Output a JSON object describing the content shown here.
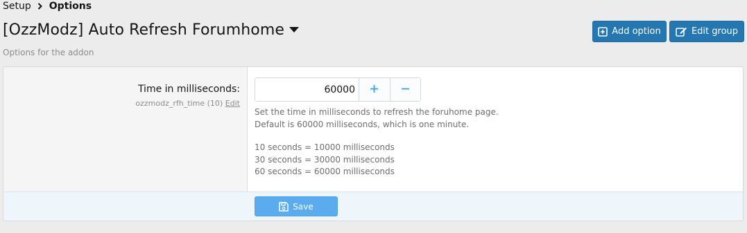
{
  "breadcrumb": {
    "parent": "Setup",
    "current": "Options"
  },
  "header": {
    "title": "[OzzModz] Auto Refresh Forumhome",
    "subtitle": "Options for the addon",
    "add_option_label": "Add option",
    "edit_group_label": "Edit group"
  },
  "option": {
    "label": "Time in milliseconds:",
    "hint_id": "ozzmodz_rfh_time (10)",
    "hint_edit": "Edit",
    "value": "60000",
    "description": [
      "Set the time in milliseconds to refresh the foruhome page.",
      "Default is 60000 milliseconds, which is one minute."
    ],
    "examples": [
      "10 seconds = 10000 milliseconds",
      "30 seconds = 30000 milliseconds",
      "60 seconds = 60000 milliseconds"
    ]
  },
  "footer": {
    "save_label": "Save"
  },
  "colors": {
    "primary_button": "#2577b1",
    "save_button": "#5aacef",
    "spin_icon": "#47a7eb"
  },
  "icons": {
    "breadcrumb_separator": "chevron-right-icon",
    "title_dropdown": "caret-down-icon",
    "add": "plus-square-icon",
    "edit": "edit-icon",
    "increment": "plus-icon",
    "decrement": "minus-icon",
    "save": "save-icon"
  }
}
